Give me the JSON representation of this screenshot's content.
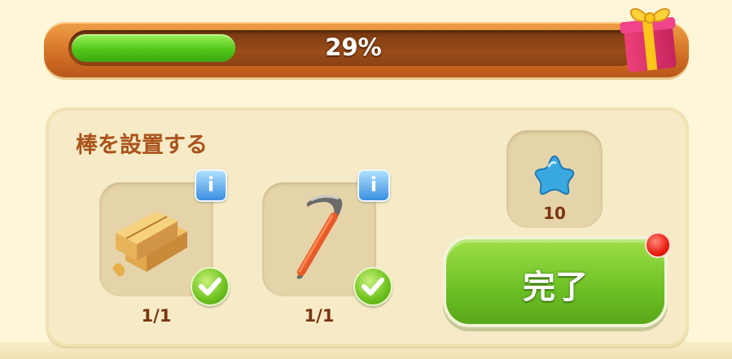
{
  "progress": {
    "value": 0.29,
    "label": "29%"
  },
  "task": {
    "title": "棒を設置する"
  },
  "items": [
    {
      "icon": "wood-planks-icon",
      "count": "1/1",
      "completed": true
    },
    {
      "icon": "crowbar-icon",
      "count": "1/1",
      "completed": true
    }
  ],
  "info_label": "i",
  "reward": {
    "icon": "blue-star-icon",
    "amount": "10"
  },
  "complete_button": {
    "label": "完了"
  },
  "colors": {
    "progress_fill": "#52c81a",
    "progress_frame": "#d47326",
    "title_text": "#a9521b",
    "button_green": "#6cbf24",
    "notification_red": "#e81c10"
  }
}
